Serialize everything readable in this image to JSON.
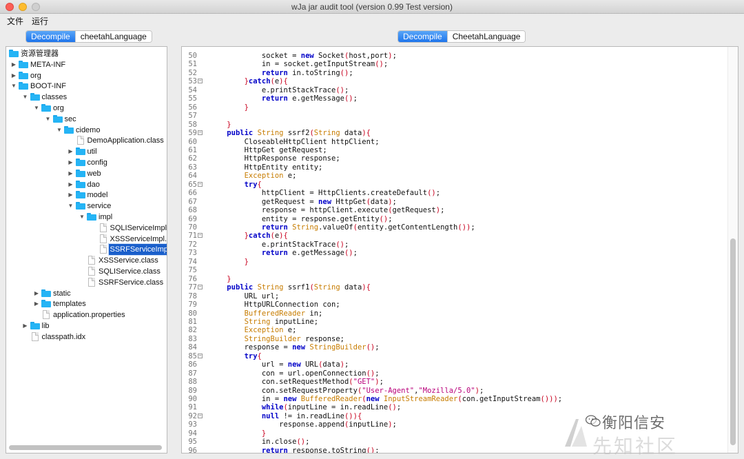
{
  "window": {
    "title": "wJa jar audit tool (version 0.99 Test version)"
  },
  "menu": {
    "items": [
      "文件",
      "运行"
    ]
  },
  "left_tabs": {
    "tabs": [
      "Decompile",
      "cheetahLanguage"
    ],
    "active": 0
  },
  "right_tabs": {
    "tabs": [
      "Decompile",
      "CheetahLanguage"
    ],
    "active": 0
  },
  "tree": [
    {
      "label": "资源管理器",
      "type": "root",
      "depth": 0,
      "arrow": ""
    },
    {
      "label": "META-INF",
      "type": "folder",
      "depth": 0,
      "arrow": "collapsed"
    },
    {
      "label": "org",
      "type": "folder",
      "depth": 0,
      "arrow": "collapsed"
    },
    {
      "label": "BOOT-INF",
      "type": "folder",
      "depth": 0,
      "arrow": "expanded"
    },
    {
      "label": "classes",
      "type": "folder",
      "depth": 1,
      "arrow": "expanded"
    },
    {
      "label": "org",
      "type": "folder",
      "depth": 2,
      "arrow": "expanded"
    },
    {
      "label": "sec",
      "type": "folder",
      "depth": 3,
      "arrow": "expanded"
    },
    {
      "label": "cidemo",
      "type": "folder",
      "depth": 4,
      "arrow": "expanded"
    },
    {
      "label": "DemoApplication.class",
      "type": "file",
      "depth": 5,
      "arrow": ""
    },
    {
      "label": "util",
      "type": "folder",
      "depth": 5,
      "arrow": "collapsed"
    },
    {
      "label": "config",
      "type": "folder",
      "depth": 5,
      "arrow": "collapsed"
    },
    {
      "label": "web",
      "type": "folder",
      "depth": 5,
      "arrow": "collapsed"
    },
    {
      "label": "dao",
      "type": "folder",
      "depth": 5,
      "arrow": "collapsed"
    },
    {
      "label": "model",
      "type": "folder",
      "depth": 5,
      "arrow": "collapsed"
    },
    {
      "label": "service",
      "type": "folder",
      "depth": 5,
      "arrow": "expanded"
    },
    {
      "label": "impl",
      "type": "folder",
      "depth": 6,
      "arrow": "expanded"
    },
    {
      "label": "SQLIServiceImpl.c",
      "type": "file",
      "depth": 7,
      "arrow": ""
    },
    {
      "label": "XSSServiceImpl.c",
      "type": "file",
      "depth": 7,
      "arrow": ""
    },
    {
      "label": "SSRFServiceImpl.",
      "type": "file",
      "depth": 7,
      "arrow": "",
      "selected": true
    },
    {
      "label": "XSSService.class",
      "type": "file",
      "depth": 6,
      "arrow": ""
    },
    {
      "label": "SQLIService.class",
      "type": "file",
      "depth": 6,
      "arrow": ""
    },
    {
      "label": "SSRFService.class",
      "type": "file",
      "depth": 6,
      "arrow": ""
    },
    {
      "label": "static",
      "type": "folder",
      "depth": 2,
      "arrow": "collapsed"
    },
    {
      "label": "templates",
      "type": "folder",
      "depth": 2,
      "arrow": "collapsed"
    },
    {
      "label": "application.properties",
      "type": "file",
      "depth": 2,
      "arrow": ""
    },
    {
      "label": "lib",
      "type": "folder",
      "depth": 1,
      "arrow": "collapsed"
    },
    {
      "label": "classpath.idx",
      "type": "file",
      "depth": 1,
      "arrow": ""
    }
  ],
  "code": [
    {
      "n": "50",
      "fold": false,
      "tokens": [
        [
          "            ",
          ""
        ],
        [
          "socket",
          ""
        ],
        [
          " = ",
          ""
        ],
        [
          "new",
          "kw"
        ],
        [
          " Socket",
          ""
        ],
        [
          "(",
          "pn"
        ],
        [
          "host,port",
          ""
        ],
        [
          ")",
          "pn"
        ],
        [
          ";",
          ""
        ]
      ]
    },
    {
      "n": "51",
      "fold": false,
      "tokens": [
        [
          "            in = socket.getInputStream",
          ""
        ],
        [
          "()",
          "pn"
        ],
        [
          ";",
          ""
        ]
      ]
    },
    {
      "n": "52",
      "fold": false,
      "tokens": [
        [
          "            ",
          ""
        ],
        [
          "return",
          "kw"
        ],
        [
          " in.toString",
          ""
        ],
        [
          "()",
          "pn"
        ],
        [
          ";",
          ""
        ]
      ]
    },
    {
      "n": "53",
      "fold": true,
      "tokens": [
        [
          "        ",
          ""
        ],
        [
          "}",
          "pn"
        ],
        [
          "catch",
          "kw"
        ],
        [
          "(",
          "pn"
        ],
        [
          "e",
          ""
        ],
        ")",
        [
          "{",
          "pn"
        ]
      ]
    },
    {
      "n": "54",
      "fold": false,
      "tokens": [
        [
          "            e.printStackTrace",
          ""
        ],
        [
          "()",
          "pn"
        ],
        [
          ";",
          ""
        ]
      ]
    },
    {
      "n": "55",
      "fold": false,
      "tokens": [
        [
          "            ",
          ""
        ],
        [
          "return",
          "kw"
        ],
        [
          " e.getMessage",
          ""
        ],
        [
          "()",
          "pn"
        ],
        [
          ";",
          ""
        ]
      ]
    },
    {
      "n": "56",
      "fold": false,
      "tokens": [
        [
          "        ",
          ""
        ],
        [
          "}",
          "pn"
        ]
      ]
    },
    {
      "n": "57",
      "fold": false,
      "tokens": []
    },
    {
      "n": "58",
      "fold": false,
      "tokens": [
        [
          "    ",
          ""
        ],
        [
          "}",
          "pn"
        ]
      ]
    },
    {
      "n": "59",
      "fold": true,
      "tokens": [
        [
          "    ",
          ""
        ],
        [
          "public",
          "kw"
        ],
        [
          " ",
          ""
        ],
        [
          "String",
          "ty"
        ],
        [
          " ssrf2",
          ""
        ],
        [
          "(",
          "pn"
        ],
        [
          "String",
          "ty"
        ],
        [
          " data",
          ""
        ],
        [
          ")",
          "pn"
        ],
        [
          "{",
          "pn"
        ]
      ]
    },
    {
      "n": "60",
      "fold": false,
      "tokens": [
        [
          "        CloseableHttpClient httpClient;",
          ""
        ]
      ]
    },
    {
      "n": "61",
      "fold": false,
      "tokens": [
        [
          "        HttpGet getRequest;",
          ""
        ]
      ]
    },
    {
      "n": "62",
      "fold": false,
      "tokens": [
        [
          "        HttpResponse response;",
          ""
        ]
      ]
    },
    {
      "n": "63",
      "fold": false,
      "tokens": [
        [
          "        HttpEntity entity;",
          ""
        ]
      ]
    },
    {
      "n": "64",
      "fold": false,
      "tokens": [
        [
          "        ",
          ""
        ],
        [
          "Exception",
          "ty"
        ],
        [
          " e;",
          ""
        ]
      ]
    },
    {
      "n": "65",
      "fold": true,
      "tokens": [
        [
          "        ",
          ""
        ],
        [
          "try",
          "kw"
        ],
        [
          "{",
          "pn"
        ]
      ]
    },
    {
      "n": "66",
      "fold": false,
      "tokens": [
        [
          "            httpClient = HttpClients.createDefault",
          ""
        ],
        [
          "()",
          "pn"
        ],
        [
          ";",
          ""
        ]
      ]
    },
    {
      "n": "67",
      "fold": false,
      "tokens": [
        [
          "            getRequest = ",
          ""
        ],
        [
          "new",
          "kw"
        ],
        [
          " HttpGet",
          ""
        ],
        [
          "(",
          "pn"
        ],
        [
          "data",
          ""
        ],
        [
          ")",
          "pn"
        ],
        [
          ";",
          ""
        ]
      ]
    },
    {
      "n": "68",
      "fold": false,
      "tokens": [
        [
          "            response = httpClient.execute",
          ""
        ],
        [
          "(",
          "pn"
        ],
        [
          "getRequest",
          ""
        ],
        [
          ")",
          "pn"
        ],
        [
          ";",
          ""
        ]
      ]
    },
    {
      "n": "69",
      "fold": false,
      "tokens": [
        [
          "            entity = response.getEntity",
          ""
        ],
        [
          "()",
          "pn"
        ],
        [
          ";",
          ""
        ]
      ]
    },
    {
      "n": "70",
      "fold": false,
      "tokens": [
        [
          "            ",
          ""
        ],
        [
          "return",
          "kw"
        ],
        [
          " ",
          ""
        ],
        [
          "String",
          "ty"
        ],
        [
          ".valueOf",
          ""
        ],
        [
          "(",
          "pn"
        ],
        [
          "entity.getContentLength",
          ""
        ],
        [
          "())",
          "pn"
        ],
        [
          ";",
          ""
        ]
      ]
    },
    {
      "n": "71",
      "fold": true,
      "tokens": [
        [
          "        ",
          ""
        ],
        [
          "}",
          "pn"
        ],
        [
          "catch",
          "kw"
        ],
        [
          "(",
          "pn"
        ],
        [
          "e",
          ""
        ],
        [
          ")",
          "pn"
        ],
        [
          "{",
          "pn"
        ]
      ]
    },
    {
      "n": "72",
      "fold": false,
      "tokens": [
        [
          "            e.printStackTrace",
          ""
        ],
        [
          "()",
          "pn"
        ],
        [
          ";",
          ""
        ]
      ]
    },
    {
      "n": "73",
      "fold": false,
      "tokens": [
        [
          "            ",
          ""
        ],
        [
          "return",
          "kw"
        ],
        [
          " e.getMessage",
          ""
        ],
        [
          "()",
          "pn"
        ],
        [
          ";",
          ""
        ]
      ]
    },
    {
      "n": "74",
      "fold": false,
      "tokens": [
        [
          "        ",
          ""
        ],
        [
          "}",
          "pn"
        ]
      ]
    },
    {
      "n": "75",
      "fold": false,
      "tokens": []
    },
    {
      "n": "76",
      "fold": false,
      "tokens": [
        [
          "    ",
          ""
        ],
        [
          "}",
          "pn"
        ]
      ]
    },
    {
      "n": "77",
      "fold": true,
      "tokens": [
        [
          "    ",
          ""
        ],
        [
          "public",
          "kw"
        ],
        [
          " ",
          ""
        ],
        [
          "String",
          "ty"
        ],
        [
          " ssrf1",
          ""
        ],
        [
          "(",
          "pn"
        ],
        [
          "String",
          "ty"
        ],
        [
          " data",
          ""
        ],
        [
          ")",
          "pn"
        ],
        [
          "{",
          "pn"
        ]
      ]
    },
    {
      "n": "78",
      "fold": false,
      "tokens": [
        [
          "        URL url;",
          ""
        ]
      ]
    },
    {
      "n": "79",
      "fold": false,
      "tokens": [
        [
          "        HttpURLConnection con;",
          ""
        ]
      ]
    },
    {
      "n": "80",
      "fold": false,
      "tokens": [
        [
          "        ",
          ""
        ],
        [
          "BufferedReader",
          "ty"
        ],
        [
          " in;",
          ""
        ]
      ]
    },
    {
      "n": "81",
      "fold": false,
      "tokens": [
        [
          "        ",
          ""
        ],
        [
          "String",
          "ty"
        ],
        [
          " inputLine;",
          ""
        ]
      ]
    },
    {
      "n": "82",
      "fold": false,
      "tokens": [
        [
          "        ",
          ""
        ],
        [
          "Exception",
          "ty"
        ],
        [
          " e;",
          ""
        ]
      ]
    },
    {
      "n": "83",
      "fold": false,
      "tokens": [
        [
          "        ",
          ""
        ],
        [
          "StringBuilder",
          "ty"
        ],
        [
          " response;",
          ""
        ]
      ]
    },
    {
      "n": "84",
      "fold": false,
      "tokens": [
        [
          "        response = ",
          ""
        ],
        [
          "new",
          "kw"
        ],
        [
          " ",
          ""
        ],
        [
          "StringBuilder",
          "ty"
        ],
        [
          "()",
          "pn"
        ],
        [
          ";",
          ""
        ]
      ]
    },
    {
      "n": "85",
      "fold": true,
      "tokens": [
        [
          "        ",
          ""
        ],
        [
          "try",
          "kw"
        ],
        [
          "{",
          "pn"
        ]
      ]
    },
    {
      "n": "86",
      "fold": false,
      "tokens": [
        [
          "            url = ",
          ""
        ],
        [
          "new",
          "kw"
        ],
        [
          " URL",
          ""
        ],
        [
          "(",
          "pn"
        ],
        [
          "data",
          ""
        ],
        [
          ")",
          "pn"
        ],
        [
          ";",
          ""
        ]
      ]
    },
    {
      "n": "87",
      "fold": false,
      "tokens": [
        [
          "            con = url.openConnection",
          ""
        ],
        [
          "()",
          "pn"
        ],
        [
          ";",
          ""
        ]
      ]
    },
    {
      "n": "88",
      "fold": false,
      "tokens": [
        [
          "            con.setRequestMethod",
          ""
        ],
        [
          "(",
          "pn"
        ],
        [
          "\"GET\"",
          "st"
        ],
        [
          ")",
          "pn"
        ],
        [
          ";",
          ""
        ]
      ]
    },
    {
      "n": "89",
      "fold": false,
      "tokens": [
        [
          "            con.setRequestProperty",
          ""
        ],
        [
          "(",
          "pn"
        ],
        [
          "\"User-Agent\"",
          "st"
        ],
        [
          ",",
          ""
        ],
        [
          "\"Mozilla/5.0\"",
          "st"
        ],
        [
          ")",
          "pn"
        ],
        [
          ";",
          ""
        ]
      ]
    },
    {
      "n": "90",
      "fold": false,
      "tokens": [
        [
          "            in = ",
          ""
        ],
        [
          "new",
          "kw"
        ],
        [
          " ",
          ""
        ],
        [
          "BufferedReader",
          "ty"
        ],
        [
          "(",
          "pn"
        ],
        [
          "new",
          "kw"
        ],
        [
          " ",
          ""
        ],
        [
          "InputStreamReader",
          "ty"
        ],
        [
          "(",
          "pn"
        ],
        [
          "con.getInputStream",
          ""
        ],
        [
          "()))",
          "pn"
        ],
        [
          ";",
          ""
        ]
      ]
    },
    {
      "n": "91",
      "fold": false,
      "tokens": [
        [
          "            ",
          ""
        ],
        [
          "while",
          "kw"
        ],
        [
          "(",
          "pn"
        ],
        [
          "inputLine = in.readLine",
          ""
        ],
        [
          "()",
          "pn"
        ],
        [
          ";",
          ""
        ]
      ]
    },
    {
      "n": "92",
      "fold": true,
      "tokens": [
        [
          "            ",
          ""
        ],
        [
          "null",
          "kw"
        ],
        [
          " != in.readLine",
          ""
        ],
        [
          "()",
          "pn"
        ],
        [
          ")",
          "pn"
        ],
        [
          "{",
          "pn"
        ]
      ]
    },
    {
      "n": "93",
      "fold": false,
      "tokens": [
        [
          "                response.append",
          ""
        ],
        [
          "(",
          "pn"
        ],
        [
          "inputLine",
          ""
        ],
        [
          ")",
          "pn"
        ],
        [
          ";",
          ""
        ]
      ]
    },
    {
      "n": "94",
      "fold": false,
      "tokens": [
        [
          "            ",
          ""
        ],
        [
          "}",
          "pn"
        ]
      ]
    },
    {
      "n": "95",
      "fold": false,
      "tokens": [
        [
          "            in.close",
          ""
        ],
        [
          "()",
          "pn"
        ],
        [
          ";",
          ""
        ]
      ]
    },
    {
      "n": "96",
      "fold": false,
      "tokens": [
        [
          "            ",
          ""
        ],
        [
          "return",
          "kw"
        ],
        [
          " response.toString",
          ""
        ],
        [
          "()",
          "pn"
        ],
        [
          ";",
          ""
        ]
      ]
    }
  ],
  "watermark": {
    "top": "衡阳信安",
    "bottom": "先知社区"
  }
}
